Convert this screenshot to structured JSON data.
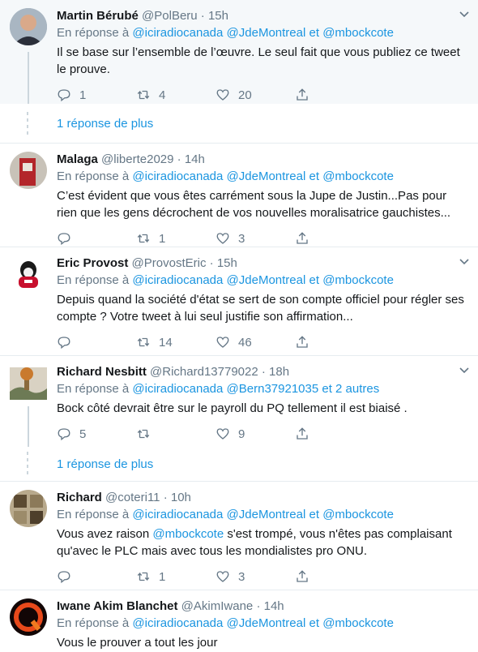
{
  "labels": {
    "replying_to": "En réponse à",
    "and": "et",
    "more_replies": "1 réponse de plus"
  },
  "colors": {
    "accent": "#1b95e0",
    "muted": "#657786",
    "divider": "#e6ecf0",
    "highlight_bg": "#f5f8fa"
  },
  "tweets": [
    {
      "name": "Martin Bérubé",
      "handle": "@PolBeru",
      "time": "15h",
      "reply_to": [
        "@iciradiocanada",
        "@JdeMontreal",
        "@mbockcote"
      ],
      "text": "Il se base sur l’ensemble de l’œuvre. Le seul fait que vous publiez ce tweet le prouve.",
      "replies": "1",
      "retweets": "4",
      "likes": "20"
    },
    {
      "name": "Malaga",
      "handle": "@liberte2029",
      "time": "14h",
      "reply_to": [
        "@iciradiocanada",
        "@JdeMontreal",
        "@mbockcote"
      ],
      "text": "C’est évident que vous êtes carrément sous la Jupe de Justin...Pas pour rien que les gens décrochent de vos nouvelles moralisatrice gauchistes...",
      "replies": "",
      "retweets": "1",
      "likes": "3"
    },
    {
      "name": "Eric Provost",
      "handle": "@ProvostEric",
      "time": "15h",
      "reply_to": [
        "@iciradiocanada",
        "@JdeMontreal",
        "@mbockcote"
      ],
      "text": "Depuis quand la société d'état se sert de son compte officiel pour régler ses compte ? Votre tweet à lui seul justifie son affirmation...",
      "replies": "",
      "retweets": "14",
      "likes": "46"
    },
    {
      "name": "Richard Nesbitt",
      "handle": "@Richard13779022",
      "time": "18h",
      "reply_to": [
        "@iciradiocanada",
        "@Bern37921035"
      ],
      "reply_extra": "et 2 autres",
      "text": "Bock côté devrait être sur le payroll du PQ tellement il est biaisé .",
      "replies": "5",
      "retweets": "",
      "likes": "9"
    },
    {
      "name": "Richard",
      "handle": "@coteri11",
      "time": "10h",
      "reply_to": [
        "@iciradiocanada",
        "@JdeMontreal",
        "@mbockcote"
      ],
      "text_parts": [
        "Vous avez raison ",
        "@mbockcote",
        " s'est trompé, vous n'êtes pas complaisant qu'avec le PLC mais avec tous les mondialistes pro ONU."
      ],
      "replies": "",
      "retweets": "1",
      "likes": "3"
    },
    {
      "name": "Iwane Akim Blanchet",
      "handle": "@AkimIwane",
      "time": "14h",
      "reply_to": [
        "@iciradiocanada",
        "@JdeMontreal",
        "@mbockcote"
      ],
      "text": "Vous le prouver a tout les jour"
    }
  ]
}
